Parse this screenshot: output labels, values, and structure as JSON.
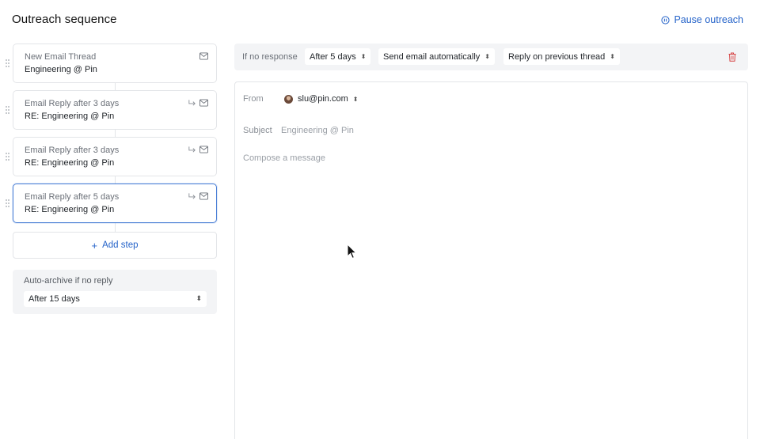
{
  "header": {
    "title": "Outreach sequence",
    "pause_label": "Pause outreach"
  },
  "steps": [
    {
      "type": "New Email Thread",
      "subject": "Engineering @ Pin",
      "icons": [
        "mail-icon"
      ],
      "selected": false
    },
    {
      "type": "Email Reply after 3 days",
      "subject": "RE: Engineering @ Pin",
      "icons": [
        "reply-icon",
        "mail-icon"
      ],
      "selected": false
    },
    {
      "type": "Email Reply after 3 days",
      "subject": "RE: Engineering @ Pin",
      "icons": [
        "reply-icon",
        "mail-icon"
      ],
      "selected": false
    },
    {
      "type": "Email Reply after 5 days",
      "subject": "RE: Engineering @ Pin",
      "icons": [
        "reply-icon",
        "mail-icon"
      ],
      "selected": true
    }
  ],
  "add_step_label": "Add step",
  "archive": {
    "label": "Auto-archive if no reply",
    "value": "After 15 days"
  },
  "condition_bar": {
    "label": "If no response",
    "delay": "After 5 days",
    "action": "Send email automatically",
    "thread": "Reply on previous thread"
  },
  "composer": {
    "from_label": "From",
    "from_value": "slu@pin.com",
    "subject_label": "Subject",
    "subject_placeholder": "Engineering @ Pin",
    "body_placeholder": "Compose a message"
  },
  "colors": {
    "accent": "#2563c9",
    "selected_border": "#4a7fd6",
    "delete": "#d64545"
  }
}
